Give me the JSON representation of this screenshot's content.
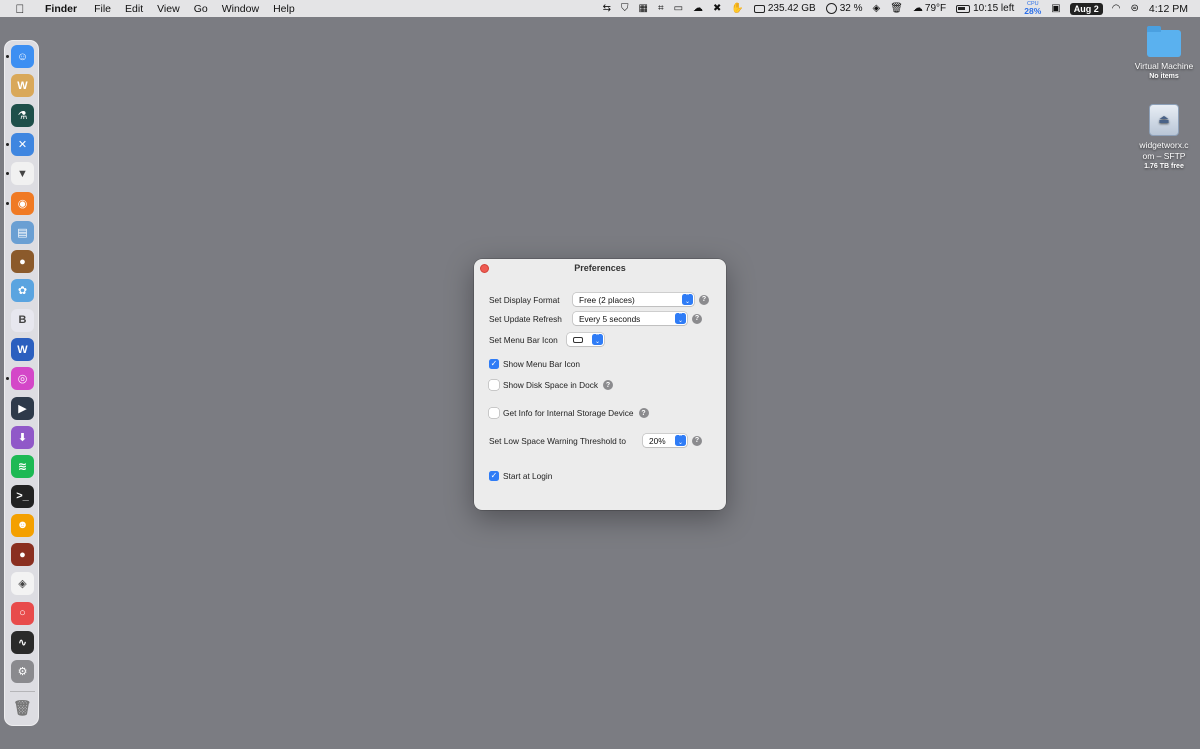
{
  "menubar": {
    "apple": "",
    "app_name": "Finder",
    "menus": [
      "File",
      "Edit",
      "View",
      "Go",
      "Window",
      "Help"
    ],
    "status": {
      "disk_free": "235.42 GB",
      "progress": "32 %",
      "weather": "79°F",
      "battery": "10:15 left",
      "cpu_label": "CPU",
      "cpu_value": "28%",
      "date": "Aug 2",
      "time": "4:12 PM"
    }
  },
  "desktop": {
    "items": [
      {
        "name": "Virtual Machine",
        "sub": "No items",
        "icon": "folder-icon"
      },
      {
        "name": "widgetworx.com – SFTP",
        "name_line1": "widgetworx.c",
        "name_line2": "om – SFTP",
        "sub": "1.76 TB free",
        "icon": "network-drive-icon"
      }
    ]
  },
  "dock": {
    "apps": [
      {
        "name": "finder",
        "color": "#3d8ff2",
        "glyph": "☺",
        "running": true
      },
      {
        "name": "word-processor",
        "color": "#d9a85a",
        "glyph": "W",
        "running": false
      },
      {
        "name": "lab",
        "color": "#1e4f4a",
        "glyph": "⚗",
        "running": false
      },
      {
        "name": "xcode-tools",
        "color": "#3f86e0",
        "glyph": "✕",
        "running": true
      },
      {
        "name": "brave",
        "color": "#f1f1f1",
        "glyph": "▼",
        "running": true
      },
      {
        "name": "firefox",
        "color": "#f07a24",
        "glyph": "◉",
        "running": true
      },
      {
        "name": "preview",
        "color": "#6a9fd3",
        "glyph": "▤",
        "running": false
      },
      {
        "name": "acorn",
        "color": "#8b5a2b",
        "glyph": "●",
        "running": false
      },
      {
        "name": "photo-app",
        "color": "#5aa4e0",
        "glyph": "✿",
        "running": false
      },
      {
        "name": "bbedit",
        "color": "#e7e7ef",
        "glyph": "B",
        "running": false
      },
      {
        "name": "microsoft-word",
        "color": "#2b5fbf",
        "glyph": "W",
        "running": false
      },
      {
        "name": "arc",
        "color": "#d447c8",
        "glyph": "◎",
        "running": true
      },
      {
        "name": "infuse",
        "color": "#2e3a4a",
        "glyph": "▶",
        "running": false
      },
      {
        "name": "downloader",
        "color": "#9058c8",
        "glyph": "⬇",
        "running": false
      },
      {
        "name": "spotify",
        "color": "#1db954",
        "glyph": "≋",
        "running": false
      },
      {
        "name": "terminal",
        "color": "#222222",
        "glyph": ">_",
        "running": false
      },
      {
        "name": "beta-app",
        "color": "#f4a000",
        "glyph": "☻",
        "running": false
      },
      {
        "name": "coffee-app",
        "color": "#8a2f20",
        "glyph": "●",
        "running": false
      },
      {
        "name": "layers-app",
        "color": "#f3f3f3",
        "glyph": "◈",
        "running": false
      },
      {
        "name": "ring-app",
        "color": "#e84b4b",
        "glyph": "○",
        "running": false
      },
      {
        "name": "activity-monitor",
        "color": "#2a2a2a",
        "glyph": "∿",
        "running": false
      },
      {
        "name": "system-settings",
        "color": "#8a8a8e",
        "glyph": "⚙",
        "running": false
      }
    ],
    "trash": {
      "name": "trash",
      "glyph": "🗑"
    }
  },
  "preferences": {
    "title": "Preferences",
    "display_format": {
      "label": "Set Display Format",
      "value": "Free (2 places)"
    },
    "update_refresh": {
      "label": "Set Update Refresh",
      "value": "Every 5 seconds"
    },
    "menu_bar_icon": {
      "label": "Set Menu Bar Icon",
      "value": "drive-icon"
    },
    "show_menu_bar_icon": {
      "label": "Show Menu Bar Icon",
      "checked": true
    },
    "show_disk_space_in_dock": {
      "label": "Show Disk Space in Dock",
      "checked": false
    },
    "get_info_internal": {
      "label": "Get Info for Internal Storage Device",
      "checked": false
    },
    "low_space_threshold": {
      "label": "Set Low Space Warning Threshold to",
      "value": "20%"
    },
    "start_at_login": {
      "label": "Start at Login",
      "checked": true
    },
    "help_glyph": "?",
    "check_glyph": "✓"
  }
}
